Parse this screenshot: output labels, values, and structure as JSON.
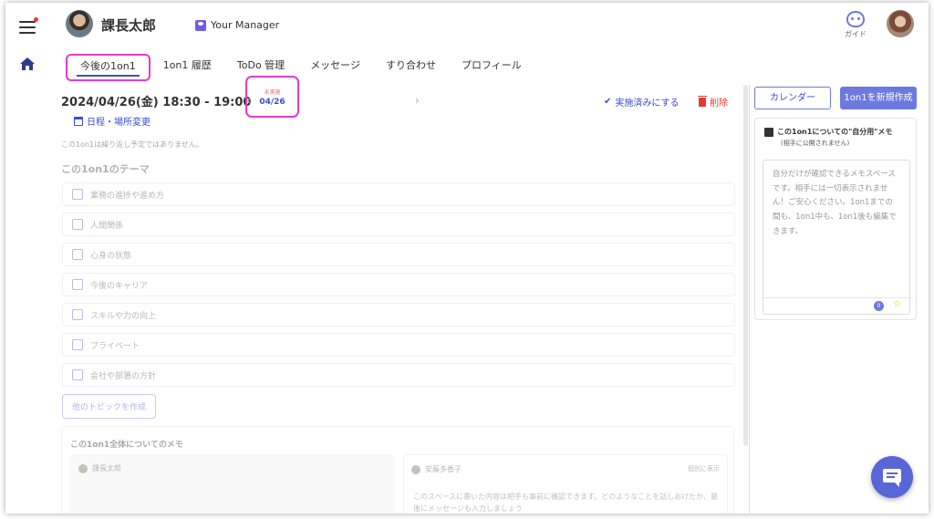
{
  "header": {
    "user_name": "課長太郎",
    "manager_label": "Your Manager",
    "guide_label": "ガイド"
  },
  "tabs": [
    {
      "label": "今後の1on1",
      "active": true
    },
    {
      "label": "1on1 履歴"
    },
    {
      "label": "ToDo 管理"
    },
    {
      "label": "メッセージ"
    },
    {
      "label": "すり合わせ"
    },
    {
      "label": "プロフィール"
    }
  ],
  "meeting": {
    "datetime": "2024/04/26(金)  18:30 - 19:00",
    "status": "未実施",
    "date_short": "04/26",
    "mark_done": "実施済みにする",
    "delete": "削除",
    "change": "日程・場所変更",
    "repeat_note": "この1on1は繰り返し予定ではありません。"
  },
  "theme": {
    "title": "この1on1のテーマ",
    "topics": [
      "業務の進捗や進め方",
      "人間関係",
      "心身の状態",
      "今後のキャリア",
      "スキルや力の向上",
      "プライベート",
      "会社や部署の方針"
    ],
    "other_topic_button": "他のトピックを作成"
  },
  "overall_memo": {
    "title": "この1on1全体についてのメモ",
    "left_author": "課長太郎",
    "right_author": "安藤多香子",
    "individual_view": "個別に表示",
    "right_text": "このスペースに書いた内容は相手も事前に確認できます。どのようなことを話しおけたか、最後にメッセージも入力しましょう"
  },
  "side": {
    "calendar_button": "カレンダー",
    "new_button": "1on1を新規作成",
    "memo_title": "この1on1についての\"自分用\"メモ",
    "memo_sub": "(相手に公開されません)",
    "memo_placeholder": "自分だけが確認できるメモスペースです。相手には一切表示されません！ご安心ください。1on1までの間も、1on1中も、1on1後も編集できます。",
    "coin_label": "0"
  },
  "colors": {
    "accent": "#3b4bd8",
    "primary_button": "#6c7ae0",
    "highlight": "#e53ad0",
    "danger": "#e53935"
  }
}
